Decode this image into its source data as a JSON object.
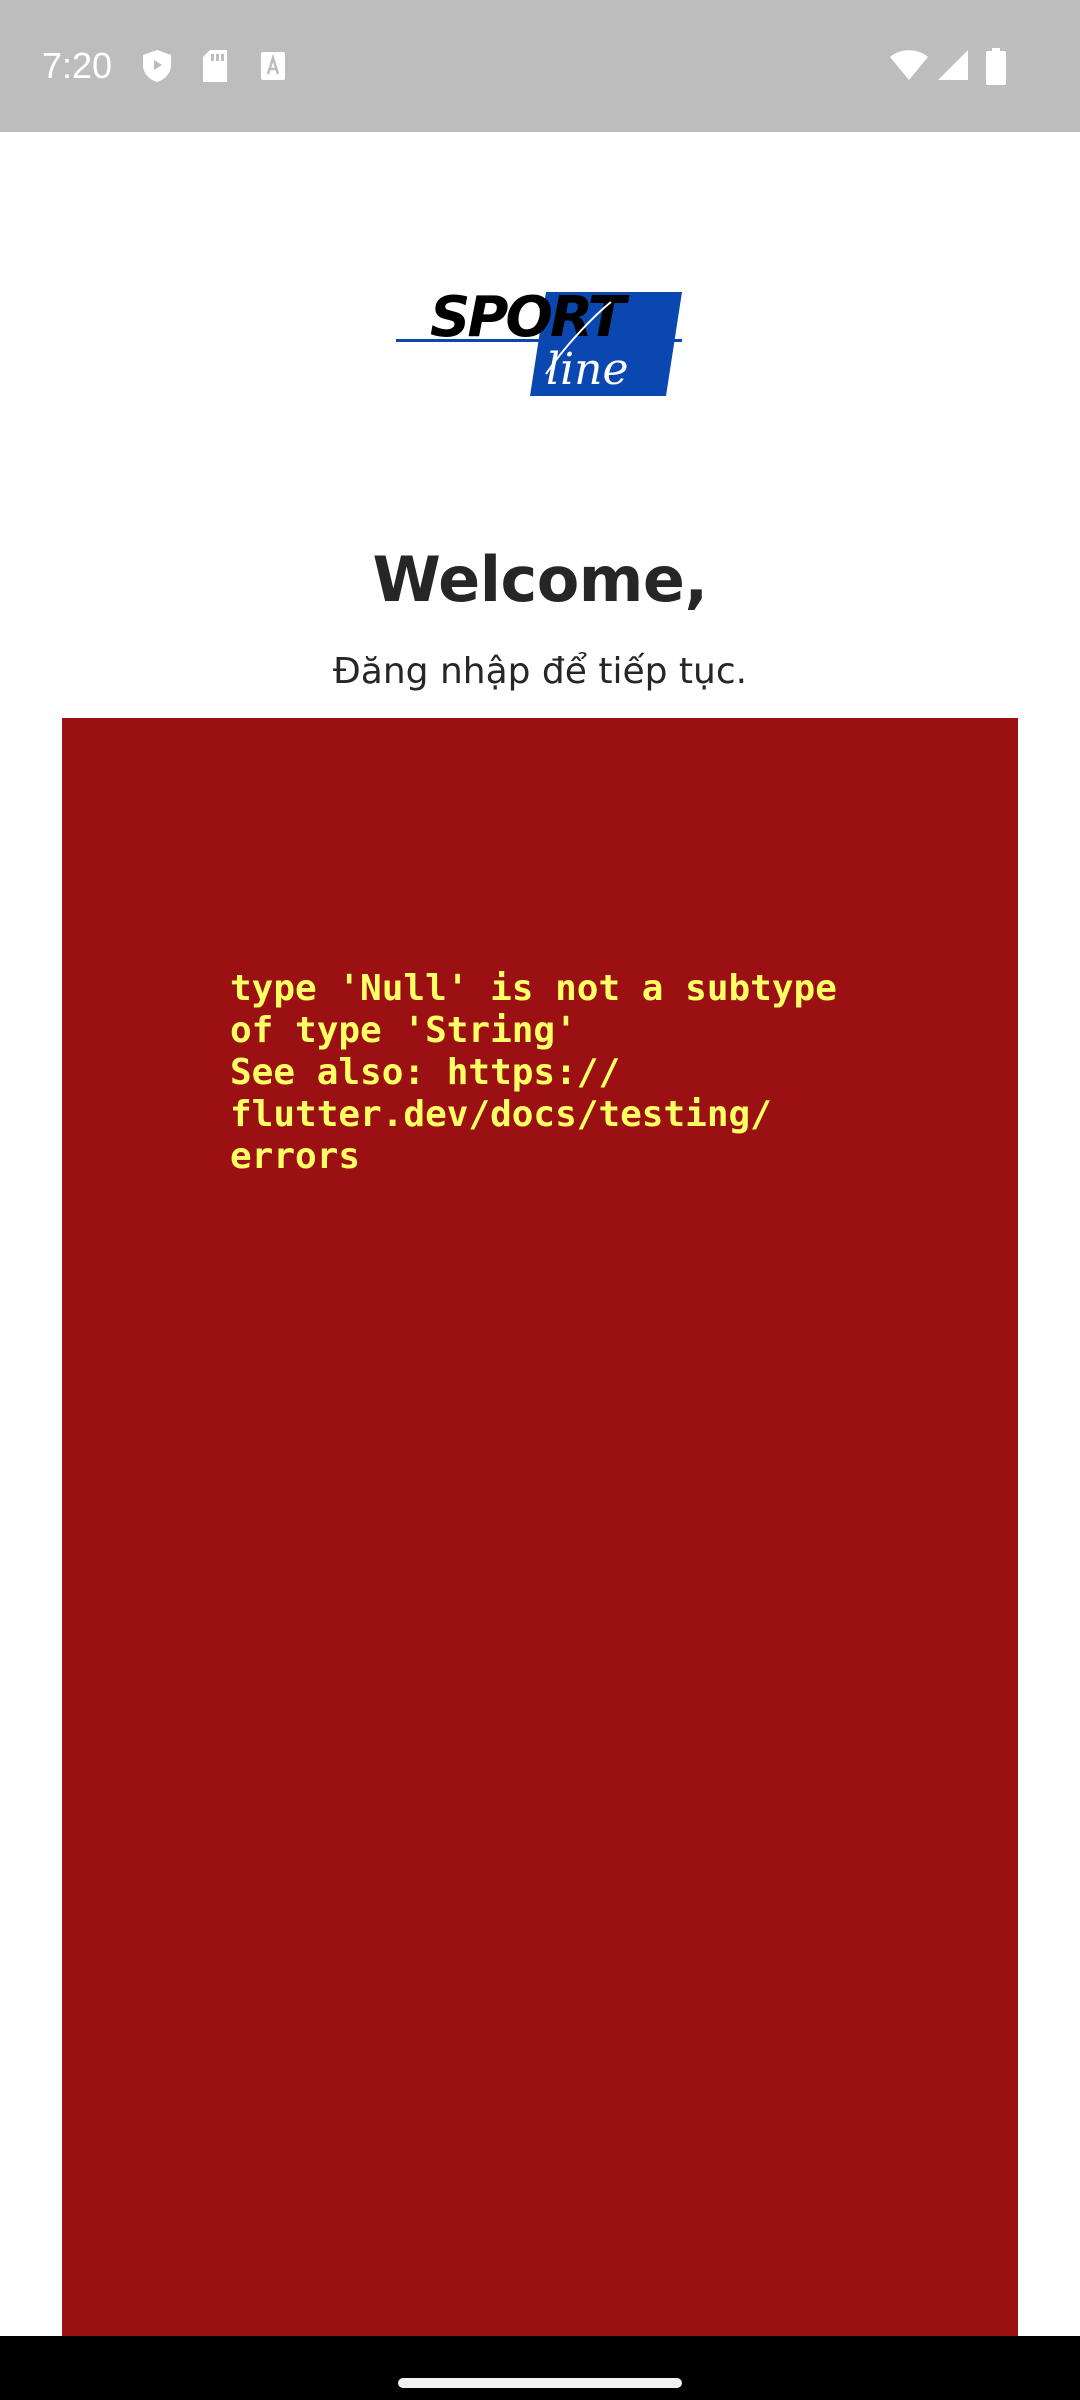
{
  "status_bar": {
    "time": "7:20",
    "left_icons": [
      "shield-icon",
      "sd-card-icon",
      "keyboard-icon"
    ],
    "right_icons": [
      "wifi-icon",
      "cellular-signal-icon",
      "battery-icon"
    ]
  },
  "logo": {
    "word_top": "SPORT",
    "word_script": "line",
    "accent_color": "#0a47b0"
  },
  "welcome": {
    "title": "Welcome,",
    "subtitle": "Đăng nhập để tiếp tục."
  },
  "error": {
    "message": "type 'Null' is not a subtype\nof type 'String'\nSee also: https://\nflutter.dev/docs/testing/\nerrors",
    "background_color": "#9a1013",
    "text_color": "#ffff66"
  }
}
